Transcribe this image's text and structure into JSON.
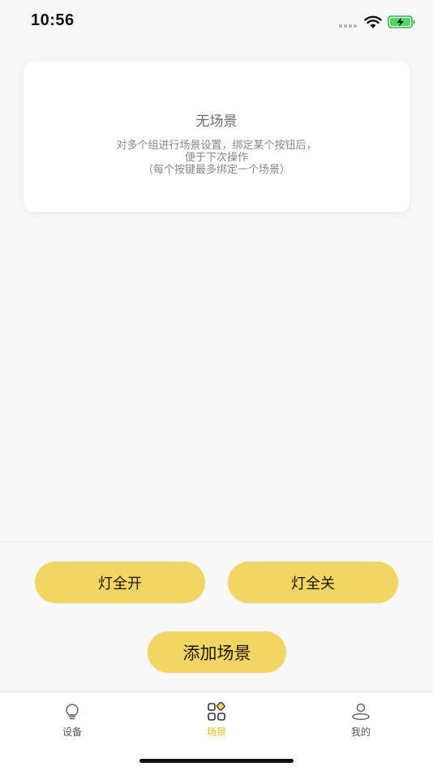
{
  "status_bar": {
    "time": "10:56"
  },
  "empty_state": {
    "title": "无场景",
    "description_lines": [
      "对多个组进行场景设置，绑定某个按钮后，",
      "便于下次操作",
      "（每个按键最多绑定一个场景）"
    ]
  },
  "actions": {
    "all_on_label": "灯全开",
    "all_off_label": "灯全关",
    "add_scene_label": "添加场景"
  },
  "tabs": [
    {
      "label": "设备",
      "icon": "bulb-icon",
      "active": false
    },
    {
      "label": "场景",
      "icon": "scene-grid-icon",
      "active": true
    },
    {
      "label": "我的",
      "icon": "person-icon",
      "active": false
    }
  ],
  "colors": {
    "accent_yellow": "#f3d564",
    "active_tab": "#e8b923",
    "background": "#f8f8f8"
  }
}
